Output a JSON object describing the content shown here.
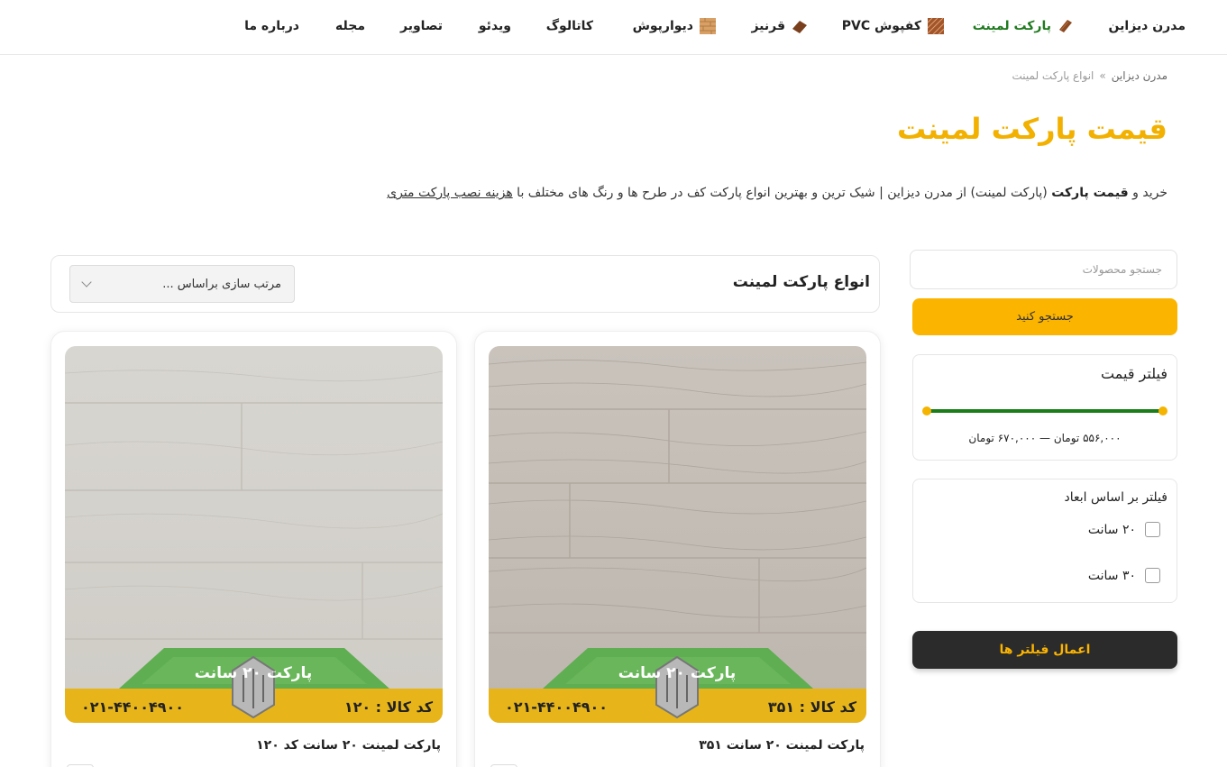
{
  "nav": {
    "items": [
      {
        "label": "مدرن دیزاین",
        "icon": "",
        "active": false
      },
      {
        "label": "پارکت لمینت",
        "icon": "laminate-plank-icon",
        "active": true
      },
      {
        "label": "کفپوش PVC",
        "icon": "pvc-tile-icon",
        "active": false
      },
      {
        "label": "قرنیز",
        "icon": "skirting-icon",
        "active": false
      },
      {
        "label": "دیوارپوش",
        "icon": "wall-panel-icon",
        "active": false
      },
      {
        "label": "کاتالوگ",
        "icon": "",
        "active": false
      },
      {
        "label": "ویدئو",
        "icon": "",
        "active": false
      },
      {
        "label": "تصاویر",
        "icon": "",
        "active": false
      },
      {
        "label": "مجله",
        "icon": "",
        "active": false
      },
      {
        "label": "درباره ما",
        "icon": "",
        "active": false
      }
    ]
  },
  "breadcrumb": {
    "home": "مدرن دیزاین",
    "separator": "»",
    "current": "انواع پارکت لمینت"
  },
  "page": {
    "title": "قیمت پارکت لمینت",
    "desc_part1": "خرید و ",
    "desc_bold": "قیمت پارکت",
    "desc_part2": " (پارکت لمینت) از مدرن دیزاین | شیک ترین و بهترین انواع پارکت کف در طرح ها و رنگ های مختلف با ",
    "desc_link": "هزینه نصب پارکت متری"
  },
  "sidebar": {
    "search_placeholder": "جستجو محصولات",
    "search_button": "جستجو کنید",
    "price_filter_title": "فیلتر قیمت",
    "price_min_label": "۵۵۶,۰۰۰ تومان",
    "price_dash": "—",
    "price_max_label": "۶۷۰,۰۰۰ تومان",
    "dimension_filter_title": "فیلتر بر اساس ابعاد",
    "dimension_options": [
      "۲۰ سانت",
      "۳۰ سانت"
    ],
    "apply_button": "اعمال فیلتر ها"
  },
  "products": {
    "header_title": "انواع پارکت لمینت",
    "sort_label": "مرتب سازی براساس ...",
    "items": [
      {
        "name": "پارکت لمینت ۲۰ سانت ۳۵۱",
        "banner_title": "پارکت ۲۰ سانت",
        "code_label": "کد کالا : ۳۵۱",
        "phone": "۰۲۱-۴۴۰۰۴۹۰۰"
      },
      {
        "name": "پارکت لمینت ۲۰ سانت کد ۱۲۰",
        "banner_title": "پارکت ۲۰ سانت",
        "code_label": "کد کالا : ۱۲۰",
        "phone": "۰۲۱-۴۴۰۰۴۹۰۰"
      }
    ]
  },
  "colors": {
    "accent_yellow": "#fbb400",
    "title_yellow": "#f2b100",
    "active_green": "#1f7a1f",
    "dark_button": "#2b2b2b",
    "banner_green": "#5fae52",
    "banner_yellow": "#e7b51a"
  }
}
